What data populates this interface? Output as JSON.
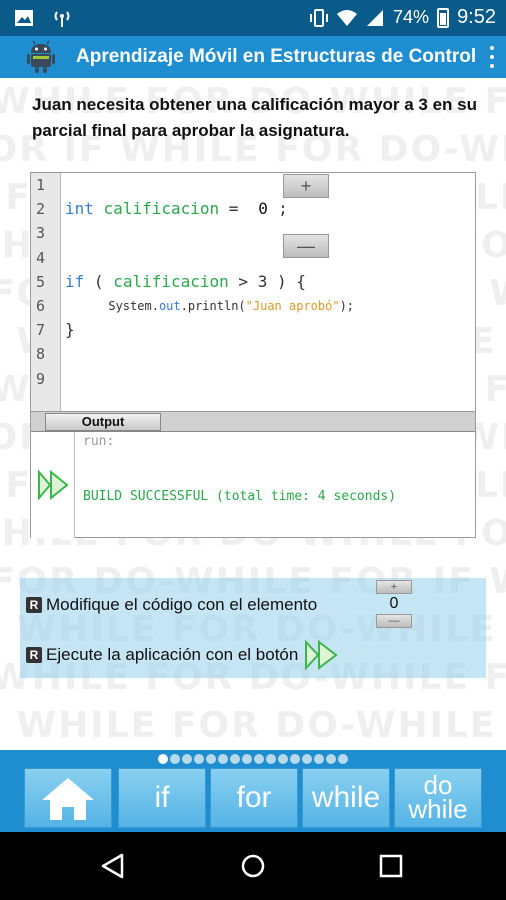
{
  "status_bar": {
    "battery_percent": "74%",
    "time": "9:52"
  },
  "app_bar": {
    "title": "Aprendizaje Móvil en Estructuras de Control"
  },
  "watermark": {
    "lines": [
      "WHILE FOR DO-WHILE FOR IF",
      "FOR IF WHILE FOR DO-WHILE FOR",
      "IF WHILE FOR DO-WHILE FOR IF",
      "WHILE FOR DO-WHILE FOR IF WH",
      "FOR DO-WHILE FOR IF WHILE FOR",
      "IF WHILE FOR DO-WHILE FOR IF",
      "WHILE FOR DO-WHILE FOR IF",
      "FOR IF WHILE FOR DO-WHILE",
      "IF WHILE FOR DO-WHILE FOR IF",
      "WHILE FOR DO-WHILE FOR IF",
      "FOR DO-WHILE FOR IF WHILE",
      "IF WHILE FOR DO-WHILE FOR IF",
      "WHILE FOR DO-WHILE FOR IF",
      "IF WHILE FOR DO-WHILE FOR",
      "WHILE FOR DO-WHILE FOR IF"
    ]
  },
  "prompt": {
    "text": "Juan necesita obtener una calificación mayor a 3 en su parcial final para aprobar la asignatura."
  },
  "editor": {
    "line_numbers": [
      "1",
      "2",
      "3",
      "4",
      "5",
      "6",
      "7",
      "8",
      "9"
    ],
    "line2": {
      "keyword": "int",
      "variable": "calificacion",
      "equals": "=",
      "value": "0",
      "semicolon": ";"
    },
    "line5": {
      "keyword": "if",
      "open": "(",
      "variable": "calificacion",
      "operator": ">",
      "number": "3",
      "close": ") {"
    },
    "line6": {
      "prefix": "System.",
      "out": "out",
      "println": ".println(",
      "string": "\"Juan aprobó\"",
      "suffix": ");"
    },
    "line7": {
      "brace": "}"
    },
    "increment_label": "+",
    "decrement_label": "—"
  },
  "output": {
    "tab_label": "Output",
    "run_text": "run:",
    "build_text": "BUILD SUCCESSFUL (total time: 4 seconds)"
  },
  "instructions": {
    "badge": "R",
    "row1": "Modifique el código con el elemento",
    "row2": "Ejecute la aplicación con el botón",
    "mini_plus": "+",
    "mini_value": "0",
    "mini_minus": "—"
  },
  "bottom_nav": {
    "tabs": [
      "if",
      "for",
      "while"
    ],
    "do_while_top": "do",
    "do_while_bottom": "while",
    "page_count": 16,
    "active_page_index": 0
  },
  "colors": {
    "status_bar": "#0a5a8a",
    "app_bar": "#1f8ed0",
    "keyword": "#3a7bd5",
    "variable": "#2aa84a",
    "string": "#e0982a",
    "run_arrow": "#3cb54a"
  }
}
